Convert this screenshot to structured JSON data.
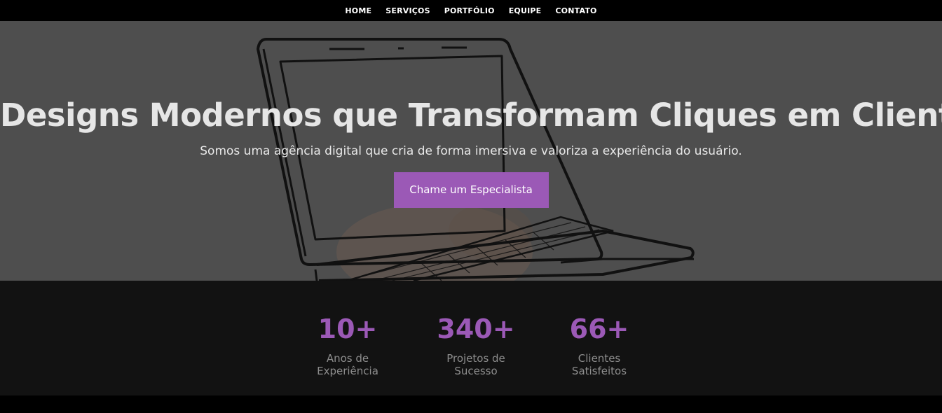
{
  "nav": {
    "items": [
      {
        "label": "HOME"
      },
      {
        "label": "SERVIÇOS"
      },
      {
        "label": "PORTFÓLIO"
      },
      {
        "label": "EQUIPE"
      },
      {
        "label": "CONTATO"
      }
    ]
  },
  "hero": {
    "title": "Designs Modernos que Transformam Cliques em Clientes",
    "subtitle": "Somos uma agência digital que cria de forma imersiva e valoriza a experiência do usuário.",
    "cta_label": "Chame um Especialista",
    "background_icon": "laptop-illustration"
  },
  "stats": [
    {
      "value": "10+",
      "label": "Anos de Experiência"
    },
    {
      "value": "340+",
      "label": "Projetos de Sucesso"
    },
    {
      "value": "66+",
      "label": "Clientes Satisfeitos"
    }
  ],
  "colors": {
    "accent": "#9b59b6",
    "hero_overlay": "#4e4e4e",
    "stats_bg": "#121212"
  }
}
